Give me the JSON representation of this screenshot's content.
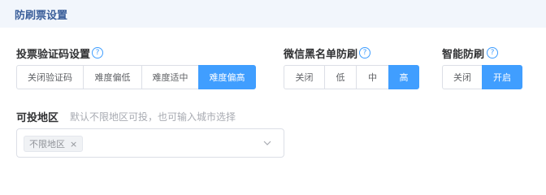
{
  "header": {
    "title": "防刷票设置"
  },
  "vote_captcha": {
    "label": "投票验证码设置",
    "help_icon": "question-circle-icon",
    "options": [
      "关闭验证码",
      "难度偏低",
      "难度适中",
      "难度偏高"
    ],
    "selected": "难度偏高"
  },
  "wechat_blacklist": {
    "label": "微信黑名单防刷",
    "help_icon": "question-circle-icon",
    "options": [
      "关闭",
      "低",
      "中",
      "高"
    ],
    "selected": "高"
  },
  "smart_antispam": {
    "label": "智能防刷",
    "help_icon": "question-circle-icon",
    "options": [
      "关闭",
      "开启"
    ],
    "selected": "开启"
  },
  "region": {
    "label": "可投地区",
    "hint": "默认不限地区可投，也可输入城市选择",
    "tags": [
      "不限地区"
    ],
    "tag_close": "×"
  },
  "colors": {
    "accent": "#409eff",
    "header_bg": "#f2f6fc",
    "header_text": "#3a5e9a"
  }
}
